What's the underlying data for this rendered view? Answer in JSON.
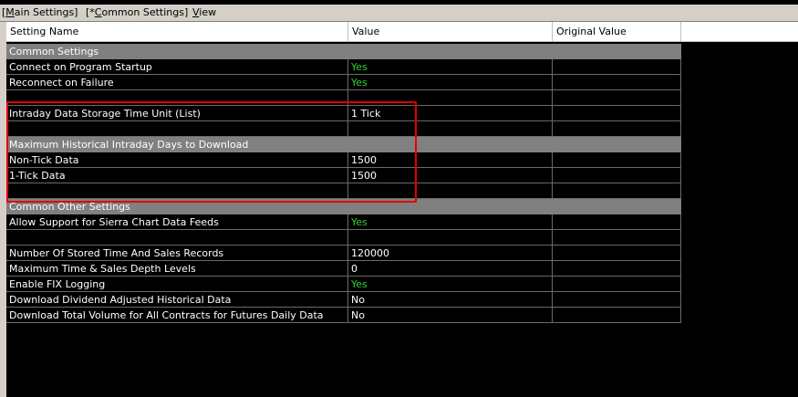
{
  "menu": [
    {
      "prefix": "[",
      "accel": "M",
      "rest": "ain Settings]"
    },
    {
      "prefix": "[*",
      "accel": "C",
      "rest": "ommon Settings]"
    },
    {
      "prefix": "",
      "accel": "V",
      "rest": "iew"
    }
  ],
  "columns": {
    "setting_name": "Setting Name",
    "value": "Value",
    "original_value": "Original Value"
  },
  "sections": {
    "common_settings": "Common Settings",
    "max_historical": "Maximum Historical Intraday Days to Download",
    "common_other": "Common Other Settings"
  },
  "rows": {
    "connect_startup": {
      "name": "Connect on Program Startup",
      "value": "Yes"
    },
    "reconnect_failure": {
      "name": "Reconnect on Failure",
      "value": "Yes"
    },
    "intraday_unit": {
      "name": "Intraday Data Storage Time Unit (List)",
      "value": "1 Tick"
    },
    "non_tick": {
      "name": "Non-Tick Data",
      "value": "1500"
    },
    "one_tick": {
      "name": "1-Tick Data",
      "value": "1500"
    },
    "sierra_feeds": {
      "name": "Allow Support for Sierra Chart Data Feeds",
      "value": "Yes"
    },
    "stored_ts": {
      "name": "Number Of Stored Time And Sales Records",
      "value": "120000"
    },
    "max_ts_depth": {
      "name": "Maximum Time & Sales Depth Levels",
      "value": "0"
    },
    "fix_logging": {
      "name": "Enable FIX Logging",
      "value": "Yes"
    },
    "dividend_adj": {
      "name": "Download Dividend Adjusted Historical Data",
      "value": "No"
    },
    "total_volume": {
      "name": "Download Total Volume for All Contracts for Futures Daily Data",
      "value": "No"
    }
  },
  "colors": {
    "yes_value": "#30d030",
    "highlight_border": "#e00000",
    "section_bg": "#808080"
  }
}
